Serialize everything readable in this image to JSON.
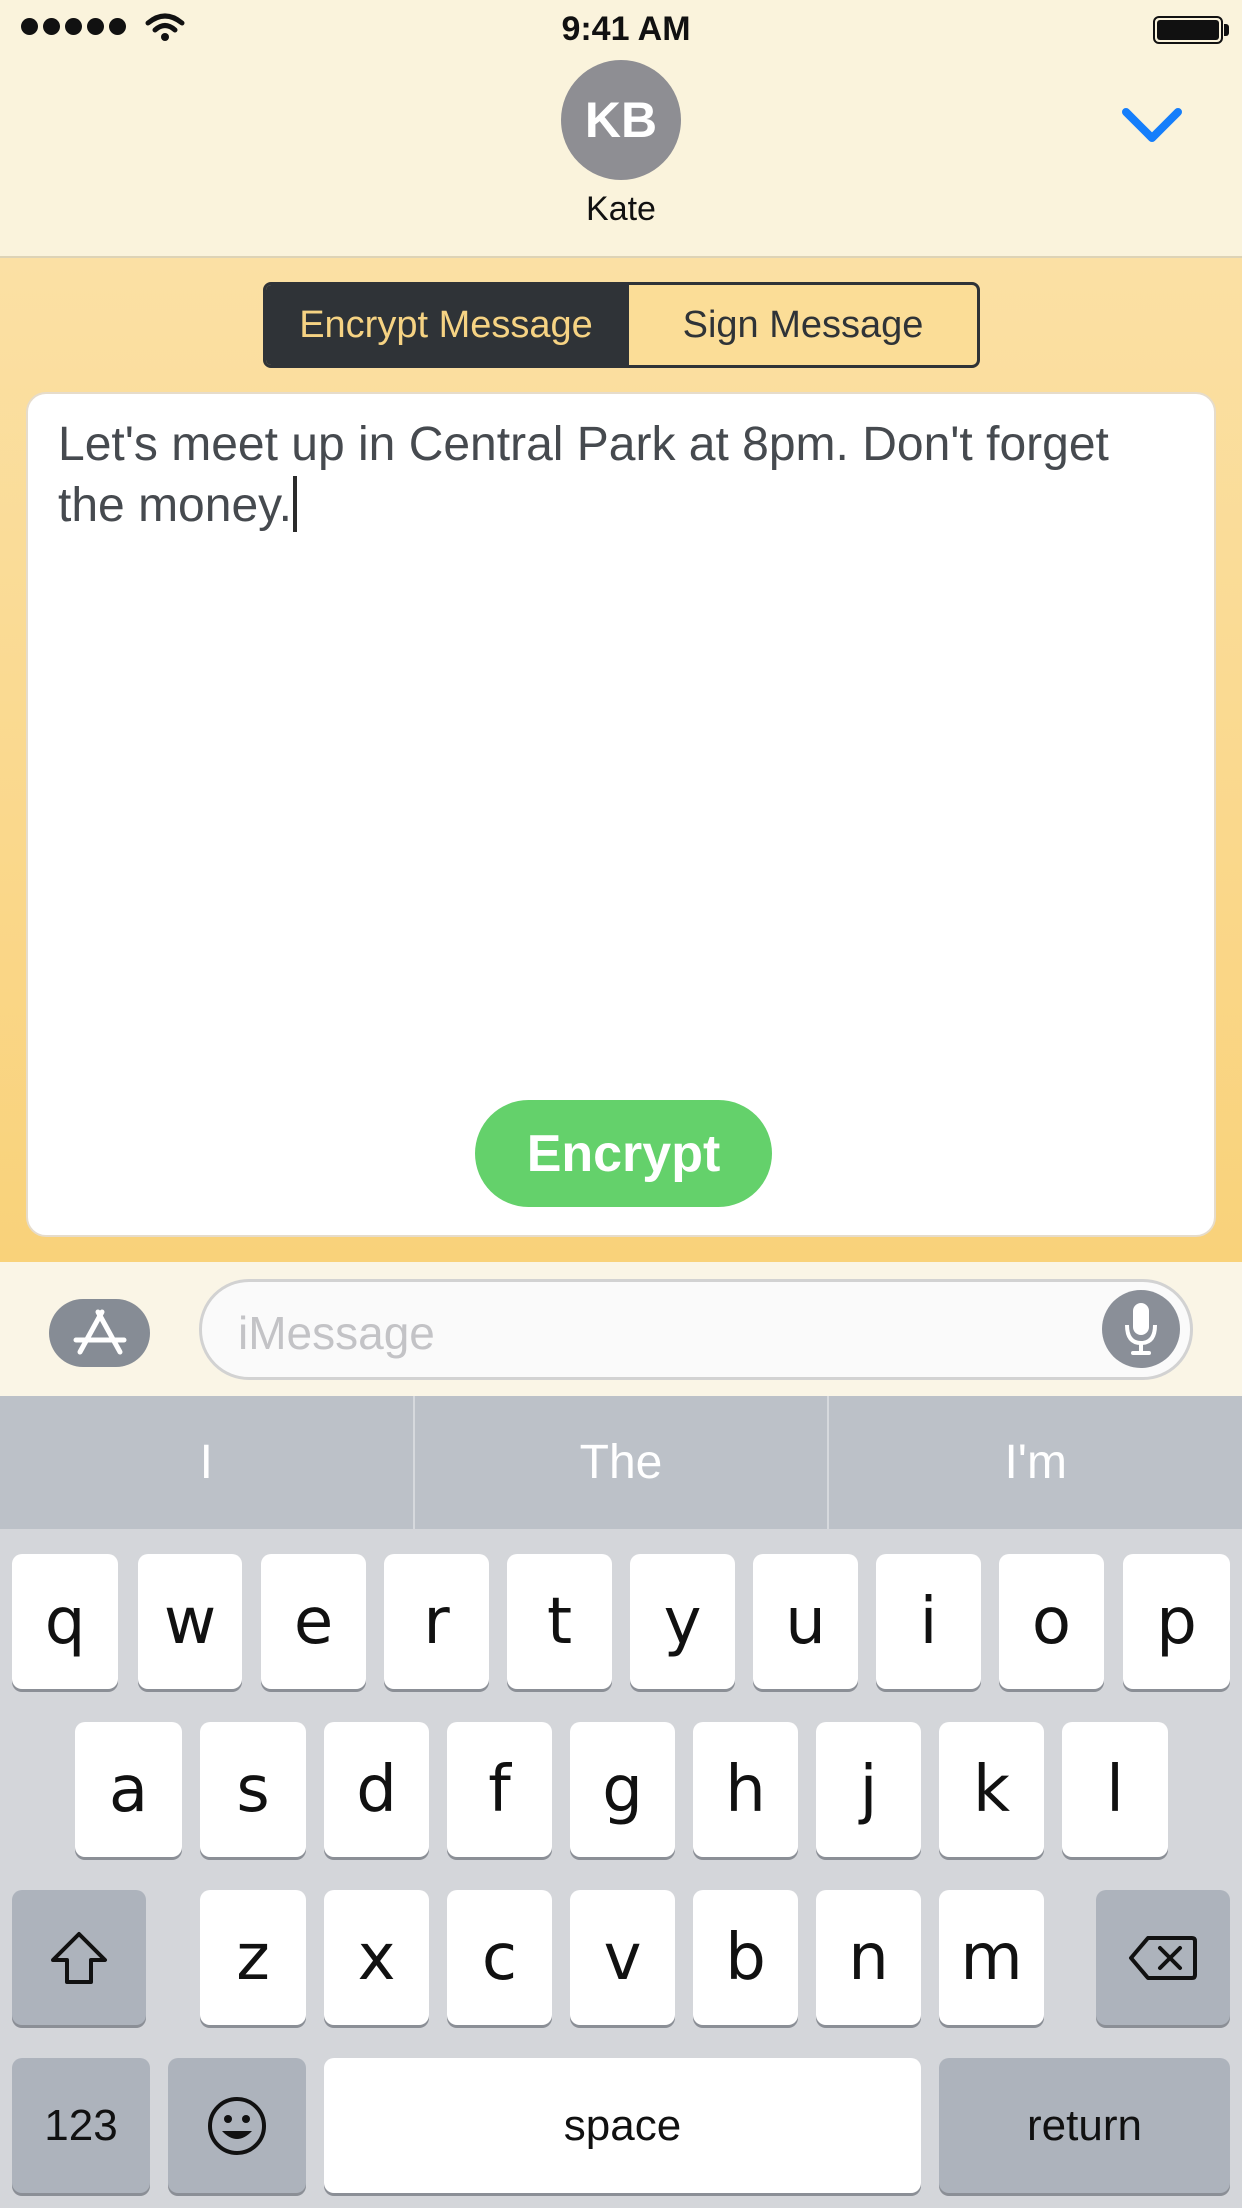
{
  "status_bar": {
    "time": "9:41 AM"
  },
  "header": {
    "avatar_initials": "KB",
    "contact_name": "Kate"
  },
  "segmented_control": {
    "left_label": "Encrypt Message",
    "right_label": "Sign Message",
    "selected": "Encrypt Message"
  },
  "message": {
    "text": "Let's meet up in Central Park at 8pm. Don't forget the money."
  },
  "encrypt_button": {
    "label": "Encrypt",
    "color": "#64d16b"
  },
  "input_bar": {
    "placeholder": "iMessage"
  },
  "suggestions": [
    "I",
    "The",
    "I'm"
  ],
  "keyboard": {
    "row1": [
      "q",
      "w",
      "e",
      "r",
      "t",
      "y",
      "u",
      "i",
      "o",
      "p"
    ],
    "row2": [
      "a",
      "s",
      "d",
      "f",
      "g",
      "h",
      "j",
      "k",
      "l"
    ],
    "row3": [
      "z",
      "x",
      "c",
      "v",
      "b",
      "n",
      "m"
    ],
    "numbers_label": "123",
    "space_label": "space",
    "return_label": "return"
  },
  "icons": [
    "wifi-icon",
    "battery-icon",
    "chevron-down-icon",
    "app-store-icon",
    "microphone-icon",
    "shift-icon",
    "delete-icon",
    "emoji-icon"
  ],
  "colors": {
    "panel": "#f9d27a",
    "segment_dark": "#2f3337",
    "accent_blue": "#157efb"
  }
}
